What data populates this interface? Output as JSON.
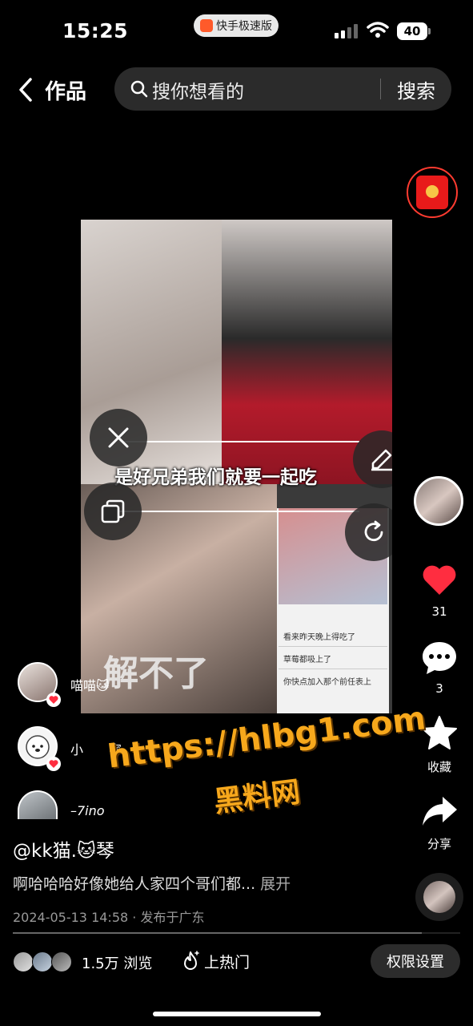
{
  "status_bar": {
    "time": "15:25",
    "app_badge": "快手极速版",
    "battery": "40"
  },
  "header": {
    "back_icon": "chevron-left-icon",
    "title": "作品",
    "search_placeholder": "搜你想看的",
    "search_button": "搜索"
  },
  "video": {
    "caption": "是好兄弟我们就要一起吃",
    "bottom_text": "解不了",
    "chat_lines": [
      "看来昨天晚上得吃了",
      "草莓都吸上了",
      "你快点加入那个前任表上"
    ]
  },
  "right_rail": {
    "likes": "31",
    "comments": "3",
    "favorite_label": "收藏",
    "share_label": "分享",
    "colors": {
      "like": "#ff2d40"
    }
  },
  "comments_overlay": [
    {
      "name": "喵喵🐱"
    },
    {
      "name": "小　　寧"
    },
    {
      "name": "–7ino"
    }
  ],
  "watermark": {
    "url": "https://hlbg1.com",
    "name": "黑料网",
    "color": "#f7a81c"
  },
  "post": {
    "author": "@kk猫.🐱琴",
    "description": "啊哈哈哈好像她给人家四个哥们都...",
    "expand": "展开",
    "date_location": "2024-05-13 14:58 · 发布于广东"
  },
  "footer": {
    "views": "1.5万 浏览",
    "hot": "上热门",
    "permission_button": "权限设置"
  }
}
